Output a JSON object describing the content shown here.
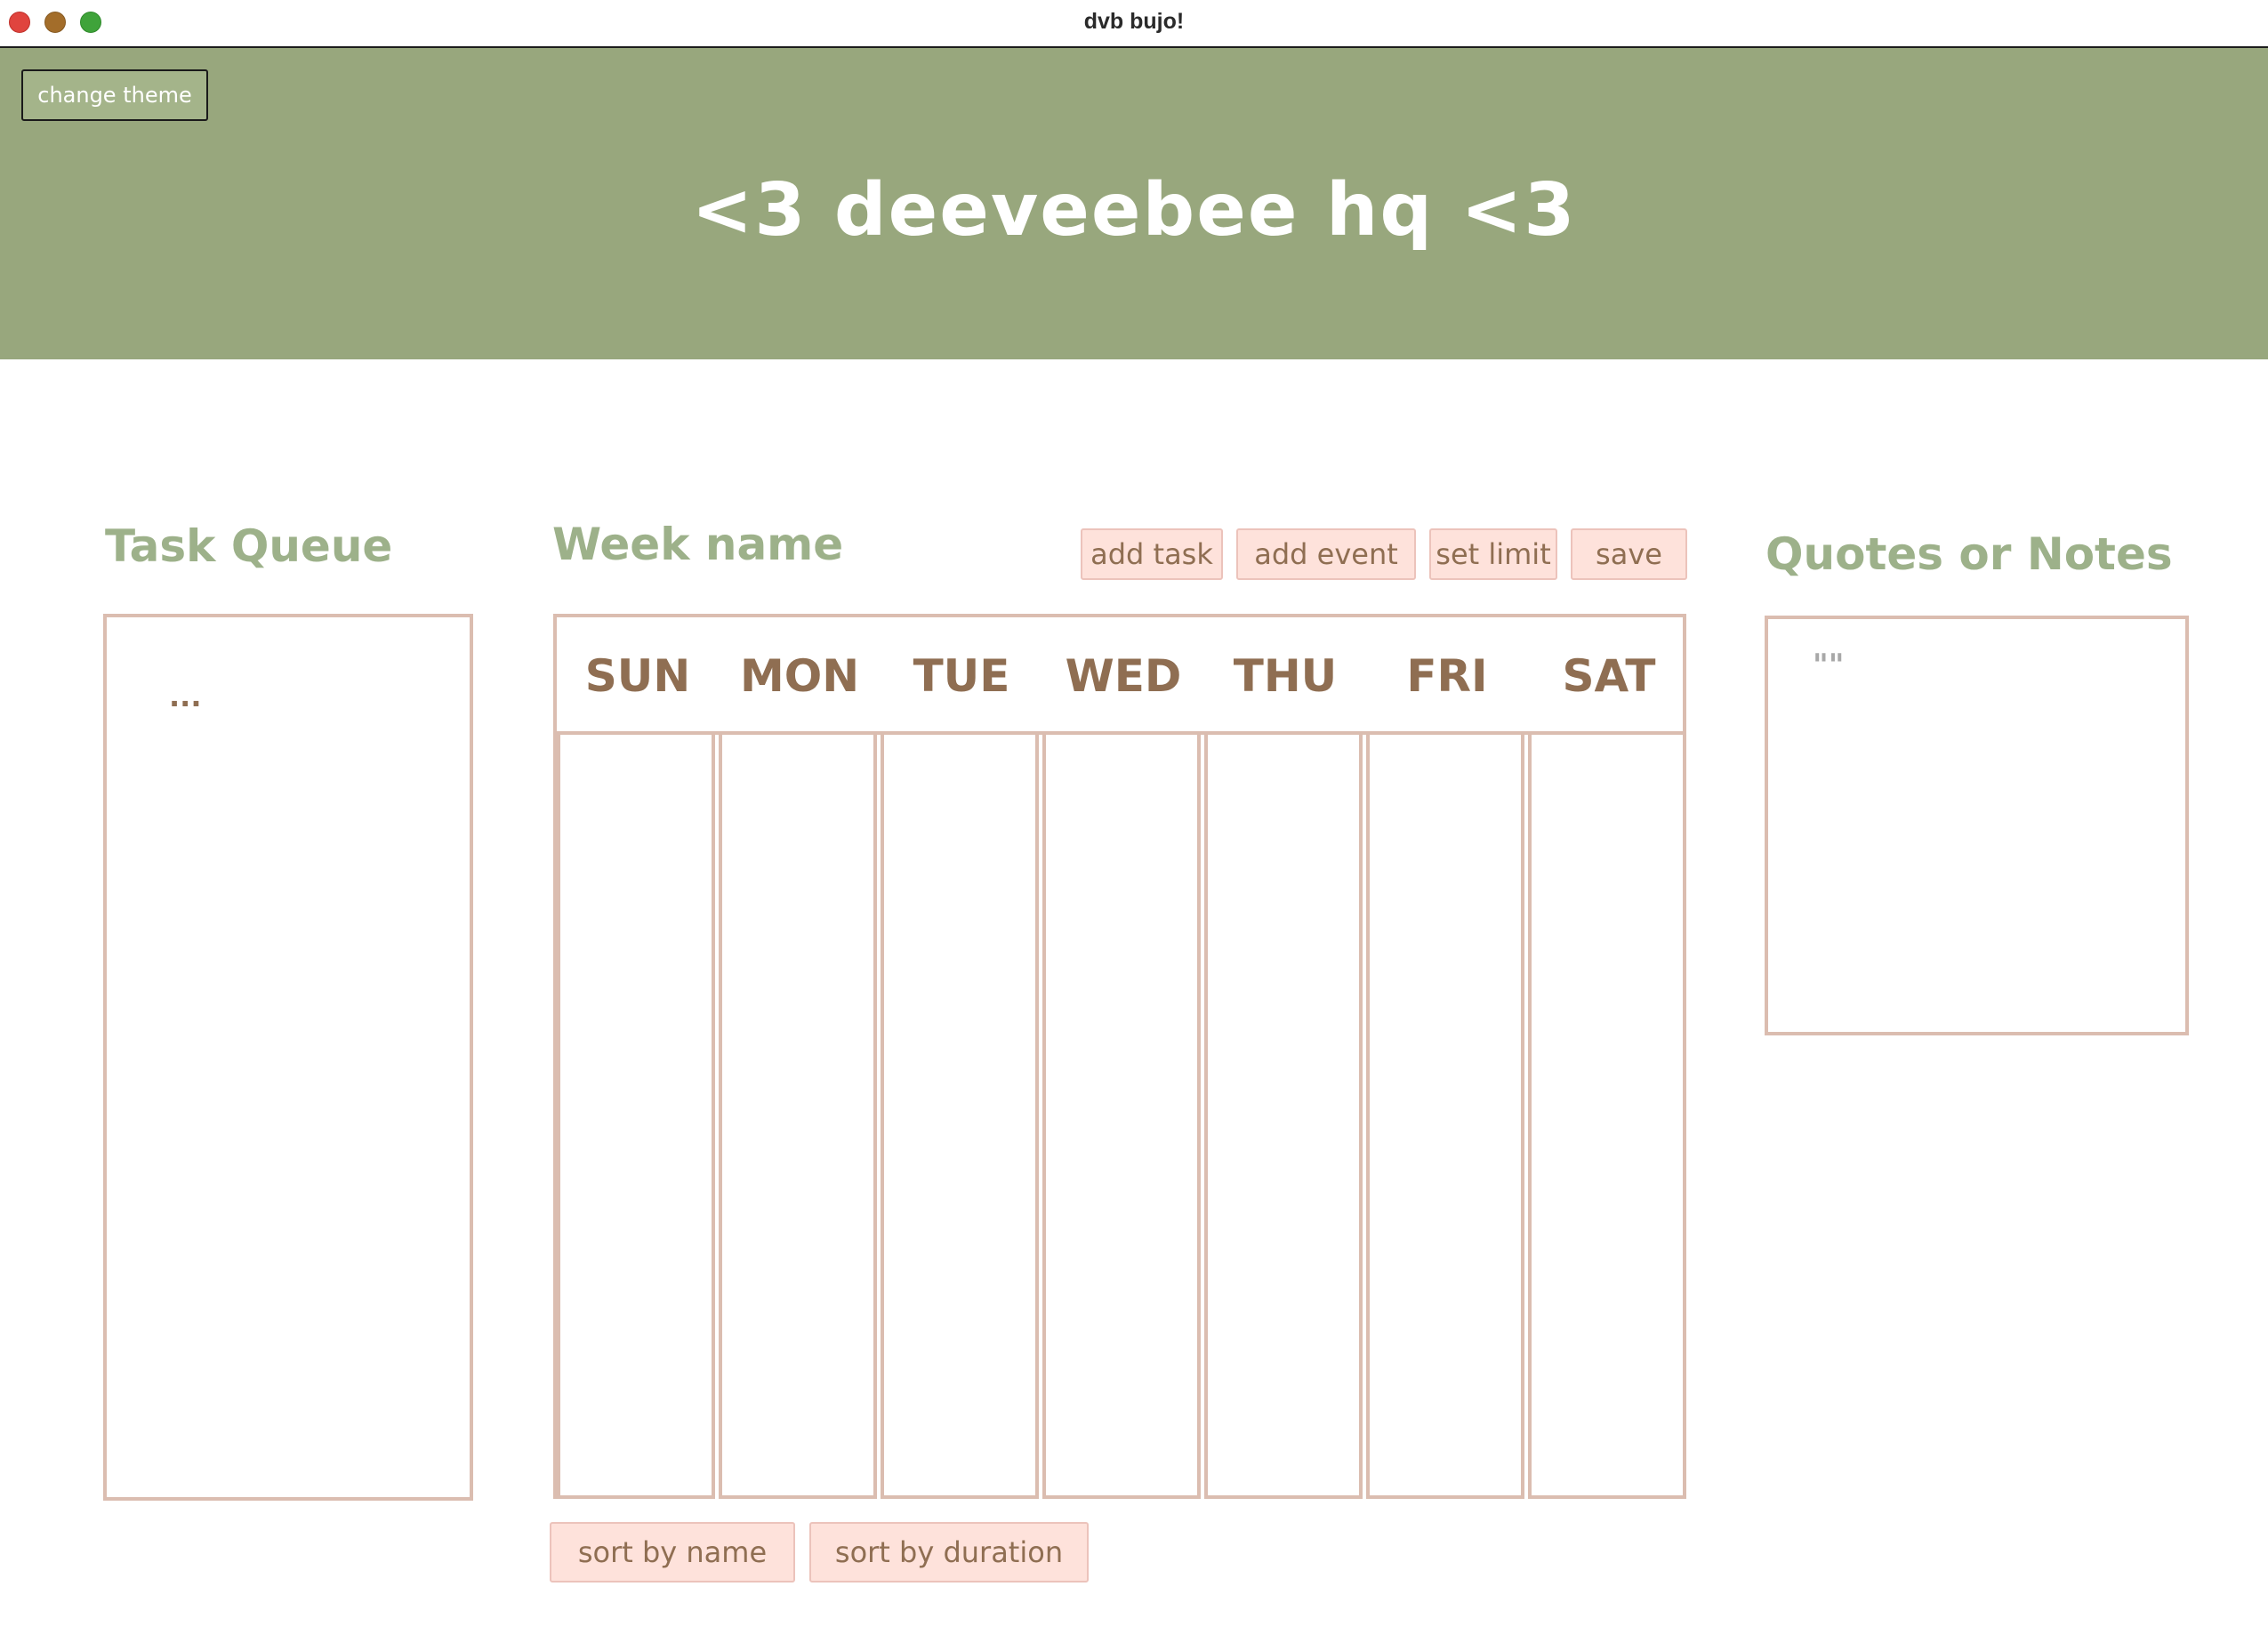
{
  "window": {
    "title": "dvb bujo!"
  },
  "header": {
    "theme_button_label": "change theme",
    "title": "<3 deeveebee hq <3"
  },
  "task_queue": {
    "heading": "Task Queue",
    "placeholder": "..."
  },
  "week": {
    "heading": "Week name",
    "actions": {
      "add_task": "add task",
      "add_event": "add event",
      "set_limit": "set limit",
      "save": "save"
    },
    "days": [
      "SUN",
      "MON",
      "TUE",
      "WED",
      "THU",
      "FRI",
      "SAT"
    ],
    "sort": {
      "by_name": "sort by name",
      "by_duration": "sort by duration"
    }
  },
  "notes": {
    "heading": "Quotes or Notes",
    "placeholder": "\"\""
  },
  "colors": {
    "banner": "#98a77d",
    "heading": "#9db18a",
    "border": "#dbbdb0",
    "button_fill": "#fee2db",
    "text_brown": "#8f6e52"
  }
}
